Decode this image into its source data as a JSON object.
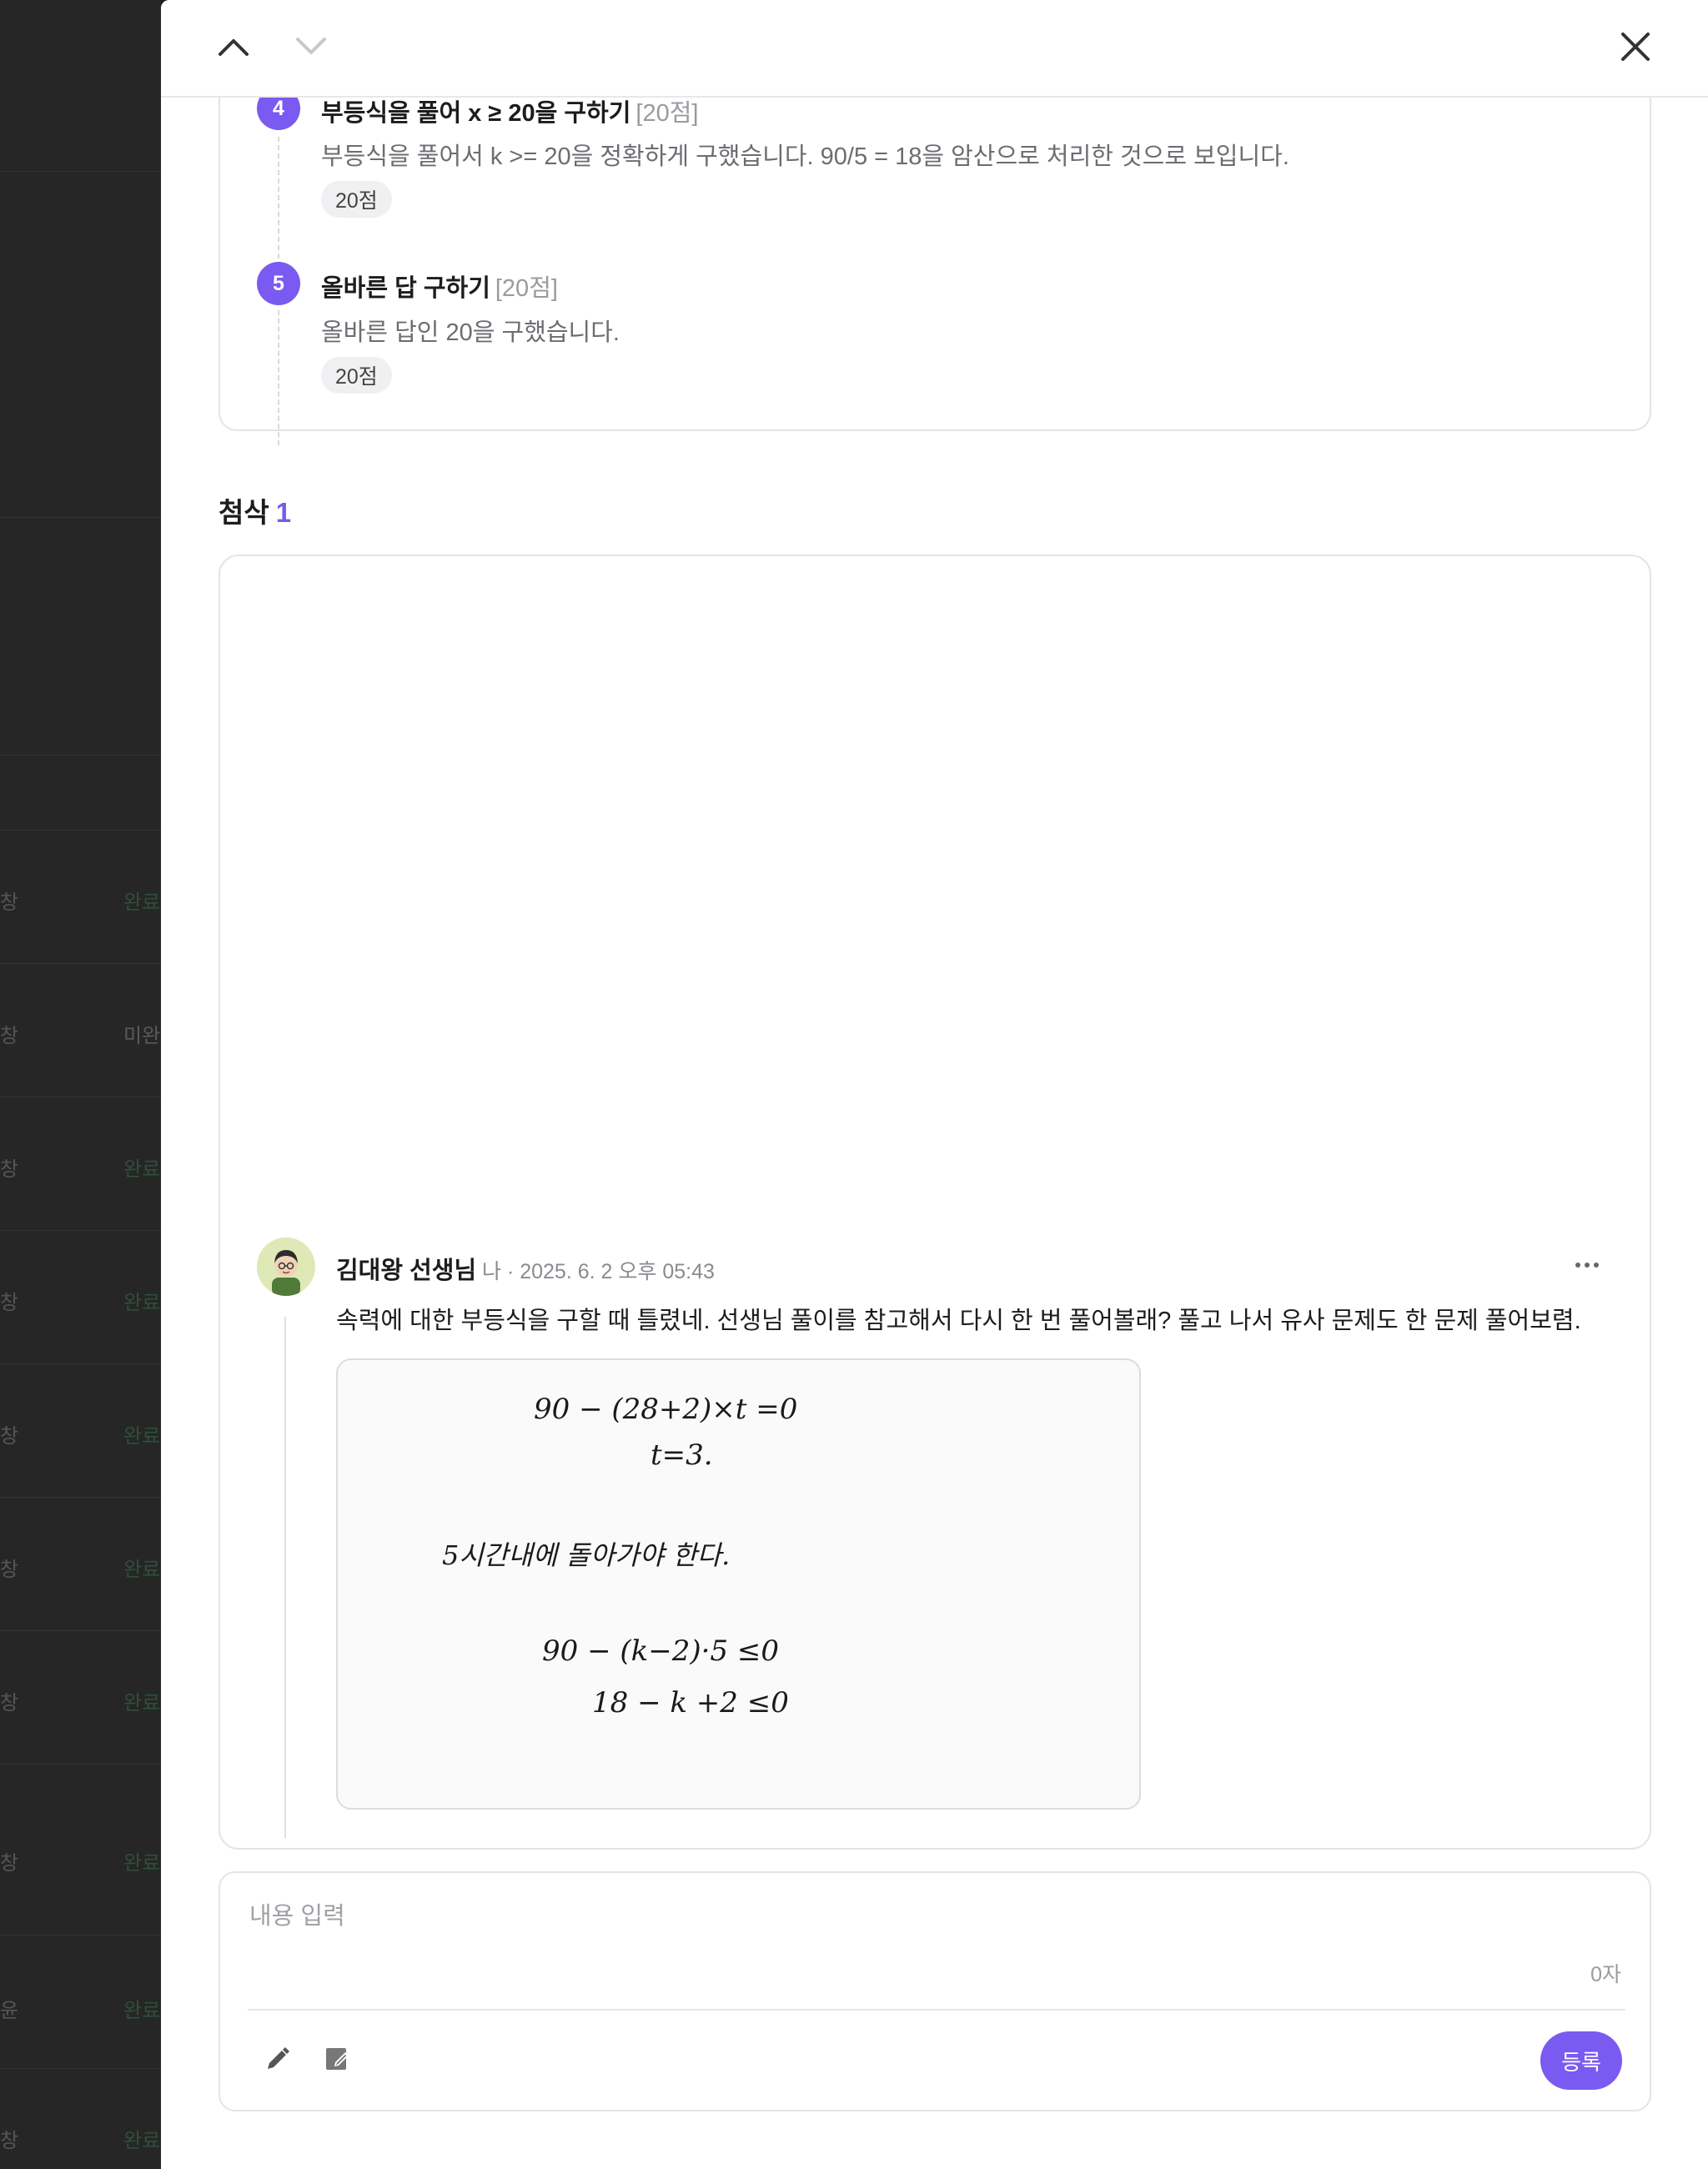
{
  "background_list": {
    "rows": [
      {
        "a": "창",
        "b": "완료"
      },
      {
        "a": "창",
        "b": "미완"
      },
      {
        "a": "창",
        "b": "완료"
      },
      {
        "a": "창",
        "b": "완료"
      },
      {
        "a": "창",
        "b": "완료"
      },
      {
        "a": "창",
        "b": "완료"
      },
      {
        "a": "창",
        "b": "완료"
      },
      {
        "a": "창",
        "b": "완료"
      },
      {
        "a": "윤",
        "b": "완료"
      },
      {
        "a": "창",
        "b": "완료"
      }
    ]
  },
  "steps": [
    {
      "number": "4",
      "title": "부등식을 풀어 x ≥ 20을 구하기",
      "points": "[20점]",
      "description": "부등식을 풀어서 k >= 20을 정확하게 구했습니다. 90/5 = 18을 암산으로 처리한 것으로 보입니다.",
      "score": "20점"
    },
    {
      "number": "5",
      "title": "올바른 답 구하기",
      "points": "[20점]",
      "description": "올바른 답인 20을 구했습니다.",
      "score": "20점"
    }
  ],
  "feedback_section": {
    "title": "첨삭",
    "count": "1"
  },
  "feedback": {
    "author": "김대왕 선생님",
    "meta": "나 · 2025. 6. 2 오후 05:43",
    "comment": "속력에 대한 부등식을 구할 때 틀렸네. 선생님 풀이를 참고해서 다시 한 번 풀어볼래? 풀고 나서 유사 문제도 한 문제 풀어보렴.",
    "handwriting": {
      "line1": "90 − (28+2)×t  =0",
      "line2": "t=3.",
      "line3": "5시간내에 돌아가야 한다.",
      "line4": "90 − (k−2)·5 ≤0",
      "line5": "18 − k +2 ≤0"
    }
  },
  "input": {
    "placeholder": "내용 입력",
    "value": "",
    "char_count": "0자",
    "submit_label": "등록"
  },
  "colors": {
    "accent": "#7a5af0",
    "text": "#1c1c1e",
    "muted": "#6c6c72"
  }
}
